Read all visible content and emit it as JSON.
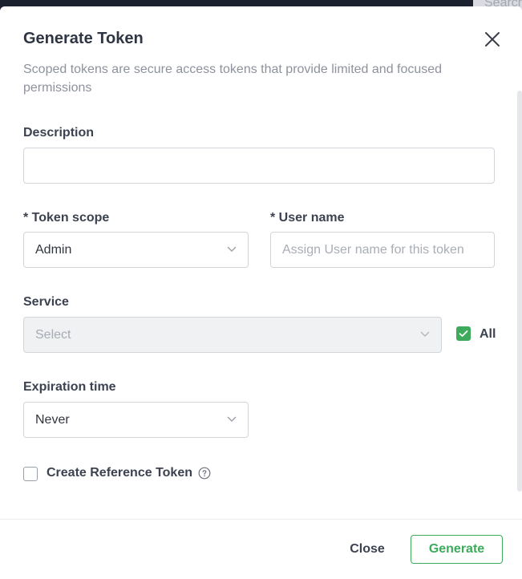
{
  "background": {
    "search_text": "Search"
  },
  "modal": {
    "title": "Generate Token",
    "subtitle": "Scoped tokens are secure access tokens that provide limited and focused permissions"
  },
  "form": {
    "description": {
      "label": "Description",
      "value": ""
    },
    "token_scope": {
      "label": "* Token scope",
      "value": "Admin"
    },
    "user_name": {
      "label": "* User name",
      "placeholder": "Assign User name for this token"
    },
    "service": {
      "label": "Service",
      "placeholder": "Select",
      "all_label": "All",
      "all_checked": true
    },
    "expiration": {
      "label": "Expiration time",
      "value": "Never"
    },
    "reference_token": {
      "label": "Create Reference Token",
      "checked": false
    }
  },
  "footer": {
    "close_label": "Close",
    "generate_label": "Generate"
  },
  "colors": {
    "accent": "#3daa5c",
    "text": "#3c4250",
    "muted": "#8d929c"
  },
  "icons": {
    "close": "close-icon",
    "chevron": "chevron-down-icon",
    "check": "check-icon",
    "help": "help-circle-icon"
  }
}
